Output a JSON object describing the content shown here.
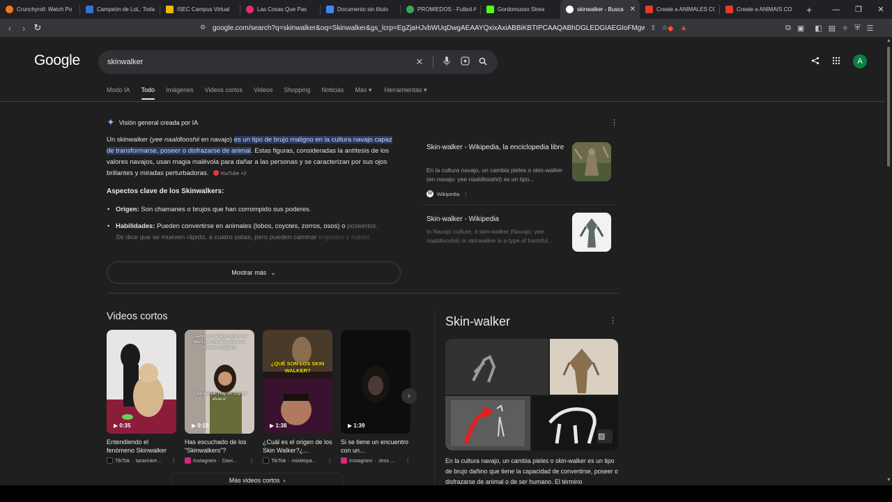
{
  "browser": {
    "tabs": [
      {
        "label": "Crunchyroll: Watch Po",
        "color": "#f47521"
      },
      {
        "label": "Campeón de LoL: Toda",
        "color": "#3b6fd8"
      },
      {
        "label": "ISEC Campus Virtual",
        "color": "#f2b705"
      },
      {
        "label": "Las Cosas Que Pas",
        "color": "#e1306c"
      },
      {
        "label": "Documento sin título",
        "color": "#4285f4"
      },
      {
        "label": "PROMIEDOS - Futbol A",
        "color": "#34a853"
      },
      {
        "label": "Gordomusso Strea",
        "color": "#53fc18"
      },
      {
        "label": "skinwalker - Busca",
        "color": "#ffffff",
        "active": true
      },
      {
        "label": "Create a ANIMALES CO",
        "color": "#e53935"
      },
      {
        "label": "Create a ANIMAIS CO",
        "color": "#e53935"
      }
    ],
    "new_tab": "+",
    "url": "google.com/search?q=skinwalker&oq=Skinwalker&gs_lcrp=EgZjaHJvbWUqDwgAEAAYQxixAxiABBiKBTIPCAAQABhDGLEDGIAEGIoFMgwIARAAGEMY..."
  },
  "google": {
    "logo": "Google",
    "query": "skinwalker",
    "avatar_letter": "A",
    "tabs": [
      "Modo IA",
      "Todo",
      "Imágenes",
      "Videos cortos",
      "Videos",
      "Shopping",
      "Noticias",
      "Más",
      "Herramientas"
    ],
    "selected_tab": "Todo"
  },
  "ai_overview": {
    "label": "Visión general creada por IA",
    "intro_1": "Un skinwalker (",
    "intro_em": "yee naaldlooshii",
    "intro_2": " en navajo) ",
    "intro_hl": "es un tipo de brujo maligno en la cultura navajo capaz de transformarse, poseer o disfrazarse de animal",
    "intro_3": ". Estas figuras, consideradas la antítesis de los valores navajos, usan magia malévola para dañar a las personas y se caracterizan por sus ojos brillantes y miradas perturbadoras.",
    "intro_source": "YouTube +2",
    "subheading": "Aspectos clave de los Skinwalkers:",
    "items": [
      {
        "term": "Origen:",
        "text": " Son chamanes o brujos que han corrompido sus poderes."
      },
      {
        "term": "Habilidades:",
        "text": " Pueden convertirse en animales (lobos, coyotes, zorros, osos) o ",
        "fade": "poseerlos. Se dice que se mueven rápido, a cuatro patas, pero pueden caminar",
        "fade2": " erguidos y hablar."
      }
    ],
    "show_more": "Mostrar más",
    "sources": [
      {
        "title": "Skin-walker - Wikipedia, la enciclopedia libre",
        "desc": "En la cultura navajo, un cambia pieles o skin-walker (en navajo: yee naaldlooshii) es un tipo...",
        "site": "Wikipedia"
      },
      {
        "title": "Skin-walker - Wikipedia",
        "desc": "In Navajo culture, a skin-walker (Navajo: yee naaldlooshii) or skinwalker is a type of harmful..."
      }
    ]
  },
  "short_videos": {
    "title": "Videos cortos",
    "items": [
      {
        "duration": "0:35",
        "caption": "Entendiendo el fenómeno Skinwalker",
        "platform": "TikTok",
        "author": "tararirare...",
        "pcolor": "#111111"
      },
      {
        "duration": "0:15",
        "caption": "Has escuchado de los \"Skinwalkers\"?",
        "platform": "Instagram",
        "author": "Davi...",
        "pcolor": "#d62976",
        "overlay": "Cuando mi amigo nativo me llevó por primera vez a su reserva indígena",
        "overlay2": "\"Que genial! Hay un coyote afuera\""
      },
      {
        "duration": "1:38",
        "caption": "¿Cuál es el origen de los Skin Walker?¿...",
        "platform": "TikTok",
        "author": "misterpa...",
        "pcolor": "#111111",
        "overlay": "¿QUÉ SON LOS SKIN WALKER?"
      },
      {
        "duration": "1:39",
        "caption": "Si se tiene un encuentro con un...",
        "platform": "Instagram",
        "author": "Jess ...",
        "pcolor": "#d62976"
      }
    ],
    "more": "Más videos cortos"
  },
  "knowledge_panel": {
    "title": "Skin-walker",
    "description": "En la cultura navajo, un cambia pieles o skin-walker es un tipo de brujo dañino que tiene la capacidad de convertirse, poseer o disfrazarse de animal o de ser humano. El término"
  }
}
